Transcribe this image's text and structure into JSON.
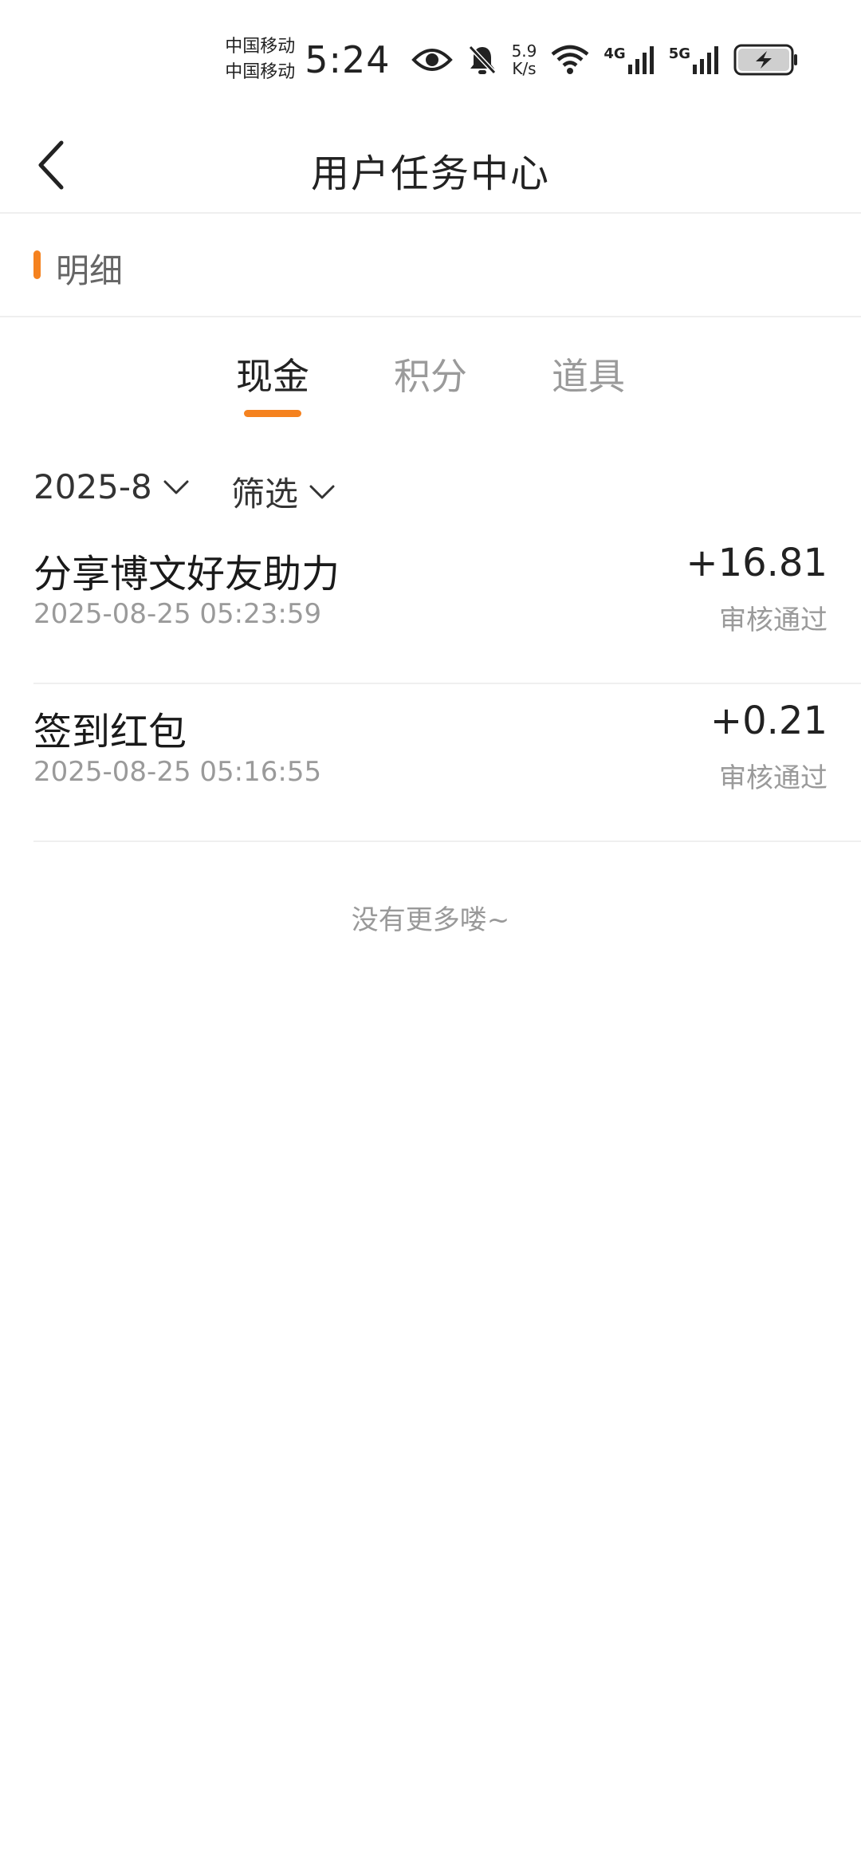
{
  "status_bar": {
    "carrier_1": "中国移动",
    "carrier_2": "中国移动",
    "time": "5:24",
    "net_speed_value": "5.9",
    "net_speed_unit": "K/s",
    "signal_1_tag": "4G",
    "signal_2_tag": "5G",
    "icons": [
      "eye-icon",
      "bell-muted-icon",
      "wifi-icon",
      "signal-icon",
      "battery-charging-icon"
    ]
  },
  "header": {
    "title": "用户任务中心",
    "back_icon": "chevron-left-icon"
  },
  "section": {
    "title": "明细",
    "accent_color": "#f5821f"
  },
  "tabs": [
    {
      "label": "现金",
      "active": true
    },
    {
      "label": "积分",
      "active": false
    },
    {
      "label": "道具",
      "active": false
    }
  ],
  "filters": {
    "month": "2025-8",
    "type": "筛选"
  },
  "records": [
    {
      "title": "分享博文好友助力",
      "time": "2025-08-25 05:23:59",
      "amount": "+16.81",
      "status": "审核通过"
    },
    {
      "title": "签到红包",
      "time": "2025-08-25 05:16:55",
      "amount": "+0.21",
      "status": "审核通过"
    }
  ],
  "end_message": "没有更多喽~"
}
